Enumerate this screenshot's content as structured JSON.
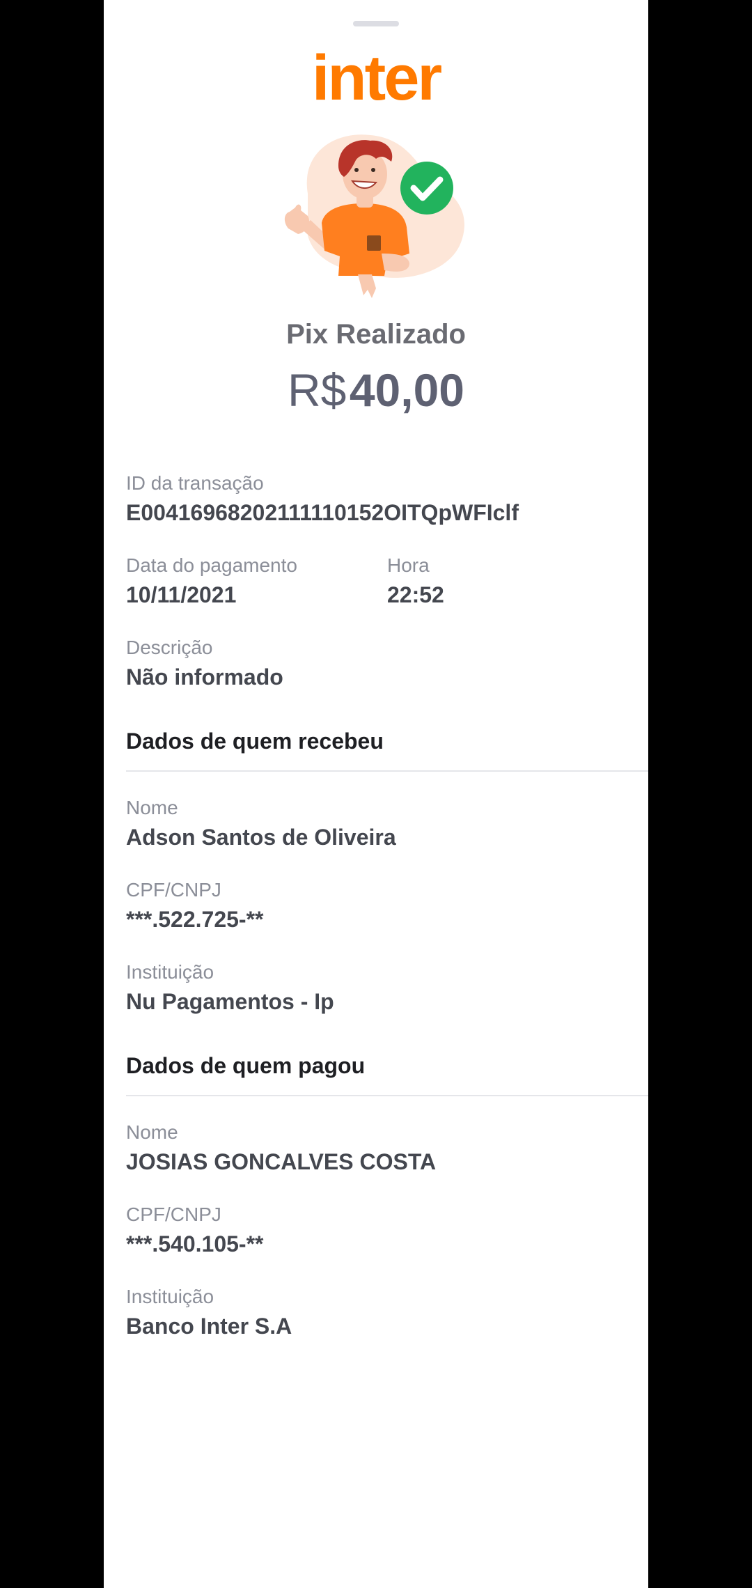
{
  "brand": {
    "logo_text": "inter",
    "color": "#ff7a00"
  },
  "status": {
    "title": "Pix Realizado",
    "currency": "R$",
    "amount": "40,00",
    "check_color": "#22b35d"
  },
  "transaction": {
    "id_label": "ID da transação",
    "id_value": "E00416968202111110152OITQpWFIclf",
    "date_label": "Data do pagamento",
    "date_value": "10/11/2021",
    "time_label": "Hora",
    "time_value": "22:52",
    "description_label": "Descrição",
    "description_value": "Não informado"
  },
  "receiver": {
    "section_title": "Dados de quem recebeu",
    "name_label": "Nome",
    "name_value": "Adson Santos de Oliveira",
    "doc_label": "CPF/CNPJ",
    "doc_value": "***.522.725-**",
    "institution_label": "Instituição",
    "institution_value": "Nu Pagamentos - Ip"
  },
  "payer": {
    "section_title": "Dados de quem pagou",
    "name_label": "Nome",
    "name_value": "JOSIAS GONCALVES COSTA",
    "doc_label": "CPF/CNPJ",
    "doc_value": "***.540.105-**",
    "institution_label": "Instituição",
    "institution_value": "Banco Inter S.A"
  }
}
